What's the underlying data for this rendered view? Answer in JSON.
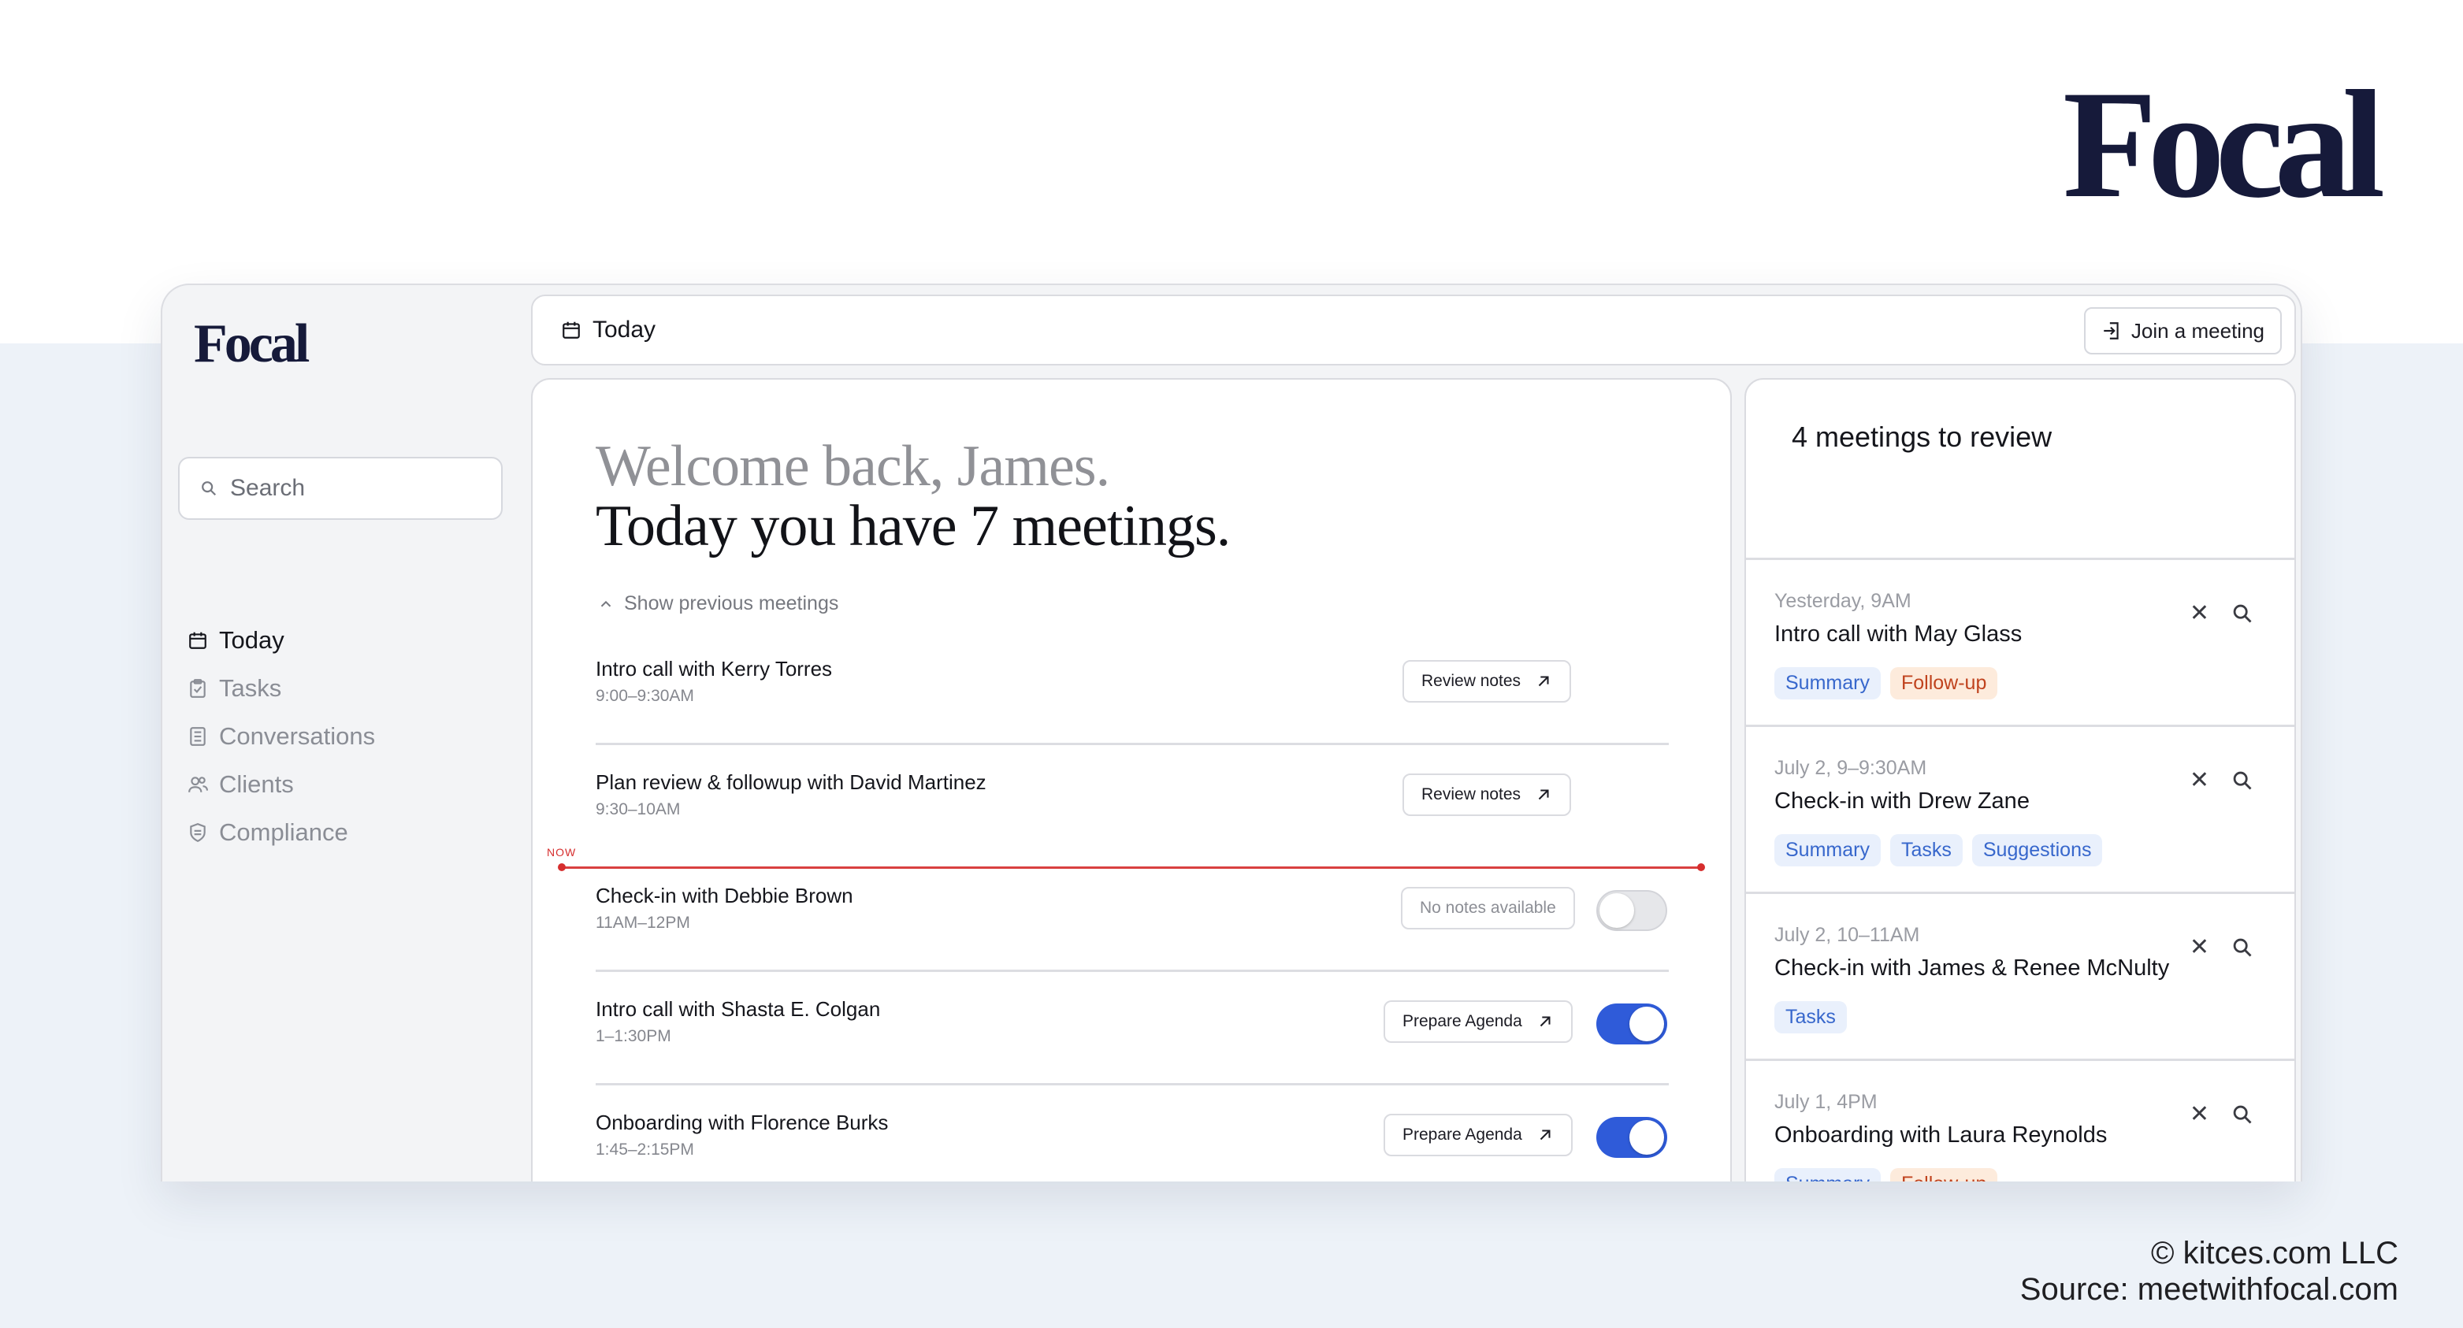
{
  "brand": {
    "logo_text": "Focal"
  },
  "credits": {
    "line1": "© kitces.com LLC",
    "line2": "Source: meetwithfocal.com"
  },
  "app": {
    "logo": "Focal",
    "search": {
      "placeholder": "Search"
    },
    "nav": [
      {
        "label": "Today",
        "icon": "calendar-icon",
        "active": true
      },
      {
        "label": "Tasks",
        "icon": "clipboard-check-icon",
        "active": false
      },
      {
        "label": "Conversations",
        "icon": "document-list-icon",
        "active": false
      },
      {
        "label": "Clients",
        "icon": "people-icon",
        "active": false
      },
      {
        "label": "Compliance",
        "icon": "shield-icon",
        "active": false
      }
    ],
    "topbar": {
      "title": "Today",
      "join_label": "Join a meeting"
    },
    "main": {
      "welcome_line1": "Welcome back, James.",
      "welcome_line2": "Today you have 7 meetings.",
      "show_previous": "Show previous meetings",
      "now_label": "NOW",
      "meetings": [
        {
          "title": "Intro call with Kerry Torres",
          "time": "9:00–9:30AM",
          "action": "Review notes",
          "toggle": null
        },
        {
          "title": "Plan review & followup with David Martinez",
          "time": "9:30–10AM",
          "action": "Review notes",
          "toggle": null
        },
        {
          "title": "Check-in with Debbie Brown",
          "time": "11AM–12PM",
          "action": "No notes available",
          "toggle": "off"
        },
        {
          "title": "Intro call with Shasta E. Colgan",
          "time": "1–1:30PM",
          "action": "Prepare Agenda",
          "toggle": "on"
        },
        {
          "title": "Onboarding with Florence Burks",
          "time": "1:45–2:15PM",
          "action": "Prepare Agenda",
          "toggle": "on"
        }
      ]
    },
    "review": {
      "title": "4 meetings to review",
      "items": [
        {
          "date": "Yesterday, 9AM",
          "title": "Intro call with May Glass",
          "tags": [
            "Summary",
            "Follow-up"
          ]
        },
        {
          "date": "July 2, 9–9:30AM",
          "title": "Check-in with Drew Zane",
          "tags": [
            "Summary",
            "Tasks",
            "Suggestions"
          ]
        },
        {
          "date": "July 2, 10–11AM",
          "title": "Check-in with James & Renee McNulty",
          "tags": [
            "Tasks"
          ]
        },
        {
          "date": "July 1, 4PM",
          "title": "Onboarding with Laura Reynolds",
          "tags": [
            "Summary",
            "Follow-up"
          ]
        }
      ]
    }
  },
  "colors": {
    "brand_navy": "#161a3a",
    "accent_blue": "#2f5bd9",
    "now_red": "#d62e2e",
    "tag_blue_text": "#3767cc",
    "tag_orange_text": "#c0431e"
  }
}
